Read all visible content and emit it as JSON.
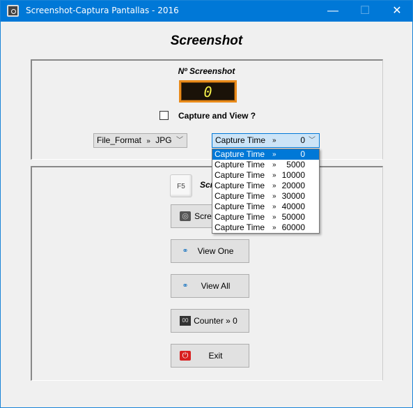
{
  "window": {
    "title": "Screenshot-Captura Pantallas - 2016",
    "minimize": "—",
    "maximize": "☐",
    "close": "✕"
  },
  "heading": "Screenshot",
  "counter": {
    "label": "Nº Screenshot",
    "value": "0"
  },
  "capture_and_view": {
    "label": "Capture and View ?",
    "checked": false
  },
  "file_format": {
    "label": "File_Format",
    "sep": "»",
    "value": "JPG"
  },
  "capture_time": {
    "label": "Capture Time",
    "sep": "»",
    "value": "0",
    "options": [
      {
        "label": "Capture Time",
        "value": "0"
      },
      {
        "label": "Capture Time",
        "value": "5000"
      },
      {
        "label": "Capture Time",
        "value": "10000"
      },
      {
        "label": "Capture Time",
        "value": "20000"
      },
      {
        "label": "Capture Time",
        "value": "30000"
      },
      {
        "label": "Capture Time",
        "value": "40000"
      },
      {
        "label": "Capture Time",
        "value": "50000"
      },
      {
        "label": "Capture Time",
        "value": "60000"
      }
    ],
    "selected_index": 0
  },
  "shortcut": {
    "key": "F5",
    "label": "Screenshot"
  },
  "buttons": [
    {
      "label": "Screenshot",
      "icon": "camera-icon"
    },
    {
      "label": "View One",
      "icon": "binoculars-icon"
    },
    {
      "label": "View All",
      "icon": "binoculars-icon"
    },
    {
      "label": "Counter » 0",
      "icon": "counter-icon"
    },
    {
      "label": "Exit",
      "icon": "power-icon"
    }
  ],
  "colors": {
    "titlebar": "#0078d7",
    "selection": "#0078d7",
    "display_border": "#e88a1a",
    "display_digit": "#f5f04a"
  }
}
